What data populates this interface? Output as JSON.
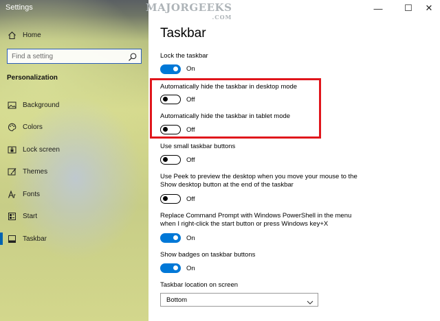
{
  "window": {
    "title": "Settings",
    "minimize_glyph": "—",
    "maximize_glyph": "☐",
    "close_glyph": "✕"
  },
  "watermark": {
    "text": "MAJORGEEKS",
    "sub": ".COM"
  },
  "sidebar": {
    "home_label": "Home",
    "search_placeholder": "Find a setting",
    "section_title": "Personalization",
    "items": [
      {
        "label": "Background",
        "icon": "picture-icon"
      },
      {
        "label": "Colors",
        "icon": "palette-icon"
      },
      {
        "label": "Lock screen",
        "icon": "lock-screen-icon"
      },
      {
        "label": "Themes",
        "icon": "brush-icon"
      },
      {
        "label": "Fonts",
        "icon": "font-icon"
      },
      {
        "label": "Start",
        "icon": "start-icon"
      },
      {
        "label": "Taskbar",
        "icon": "taskbar-icon"
      }
    ],
    "selected": "Taskbar"
  },
  "main": {
    "title": "Taskbar",
    "settings": [
      {
        "label": "Lock the taskbar",
        "state": "On",
        "on": true
      },
      {
        "label": "Automatically hide the taskbar in desktop mode",
        "state": "Off",
        "on": false
      },
      {
        "label": "Automatically hide the taskbar in tablet mode",
        "state": "Off",
        "on": false
      },
      {
        "label": "Use small taskbar buttons",
        "state": "Off",
        "on": false
      },
      {
        "label_line1": "Use Peek to preview the desktop when you move your mouse to the",
        "label_line2": "Show desktop button at the end of the taskbar",
        "state": "Off",
        "on": false
      },
      {
        "label_line1": "Replace Command Prompt with Windows PowerShell in the menu",
        "label_line2": "when I right-click the start button or press Windows key+X",
        "state": "On",
        "on": true
      },
      {
        "label": "Show badges on taskbar buttons",
        "state": "On",
        "on": true
      }
    ],
    "location_label": "Taskbar location on screen",
    "location_value": "Bottom"
  },
  "colors": {
    "accent": "#0078d7",
    "highlight_box": "#e0151b"
  }
}
